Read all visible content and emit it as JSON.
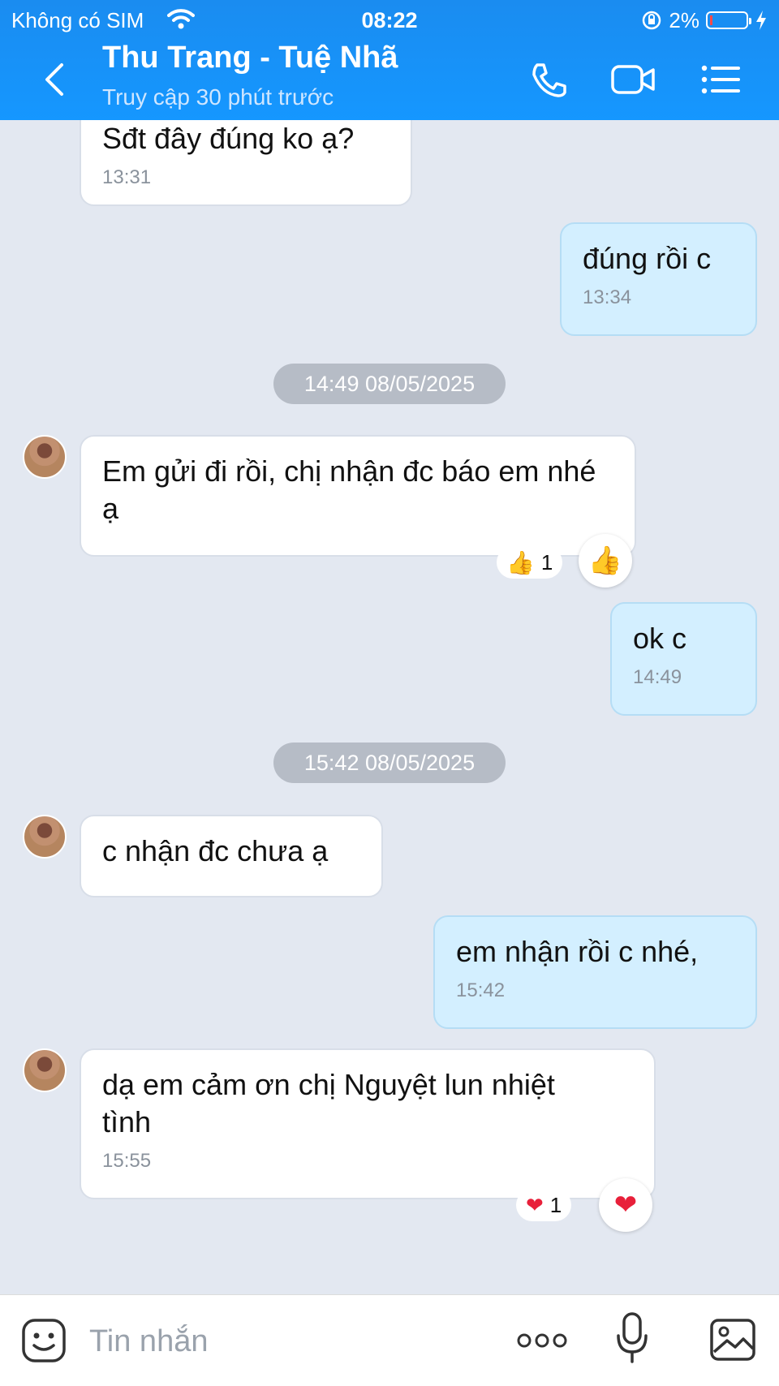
{
  "status_bar": {
    "carrier": "Không có SIM",
    "time": "08:22",
    "battery": "2%"
  },
  "header": {
    "title": "Thu Trang - Tuệ Nhã",
    "subtitle": "Truy cập 30 phút trước"
  },
  "messages": [
    {
      "text": "Sđt đây đúng ko ạ?",
      "time": "13:31"
    },
    {
      "text": "đúng rồi c",
      "time": "13:34"
    },
    {
      "text": "Em gửi đi rồi, chị nhận đc báo em nhé ạ",
      "reaction_count": "1"
    },
    {
      "text": "ok c",
      "time": "14:49"
    },
    {
      "text": "c nhận đc chưa ạ"
    },
    {
      "text": "em nhận rồi c nhé,",
      "time": "15:42"
    },
    {
      "text": "dạ em cảm ơn chị Nguyệt lun nhiệt tình",
      "time": "15:55",
      "reaction_count": "1"
    }
  ],
  "date_separators": [
    "14:49 08/05/2025",
    "15:42 08/05/2025"
  ],
  "composer": {
    "placeholder": "Tin nhắn"
  },
  "colors": {
    "header": "#1a8cf0",
    "background": "#e3e8f1",
    "my_bubble": "#d3efff",
    "their_bubble": "#ffffff"
  }
}
